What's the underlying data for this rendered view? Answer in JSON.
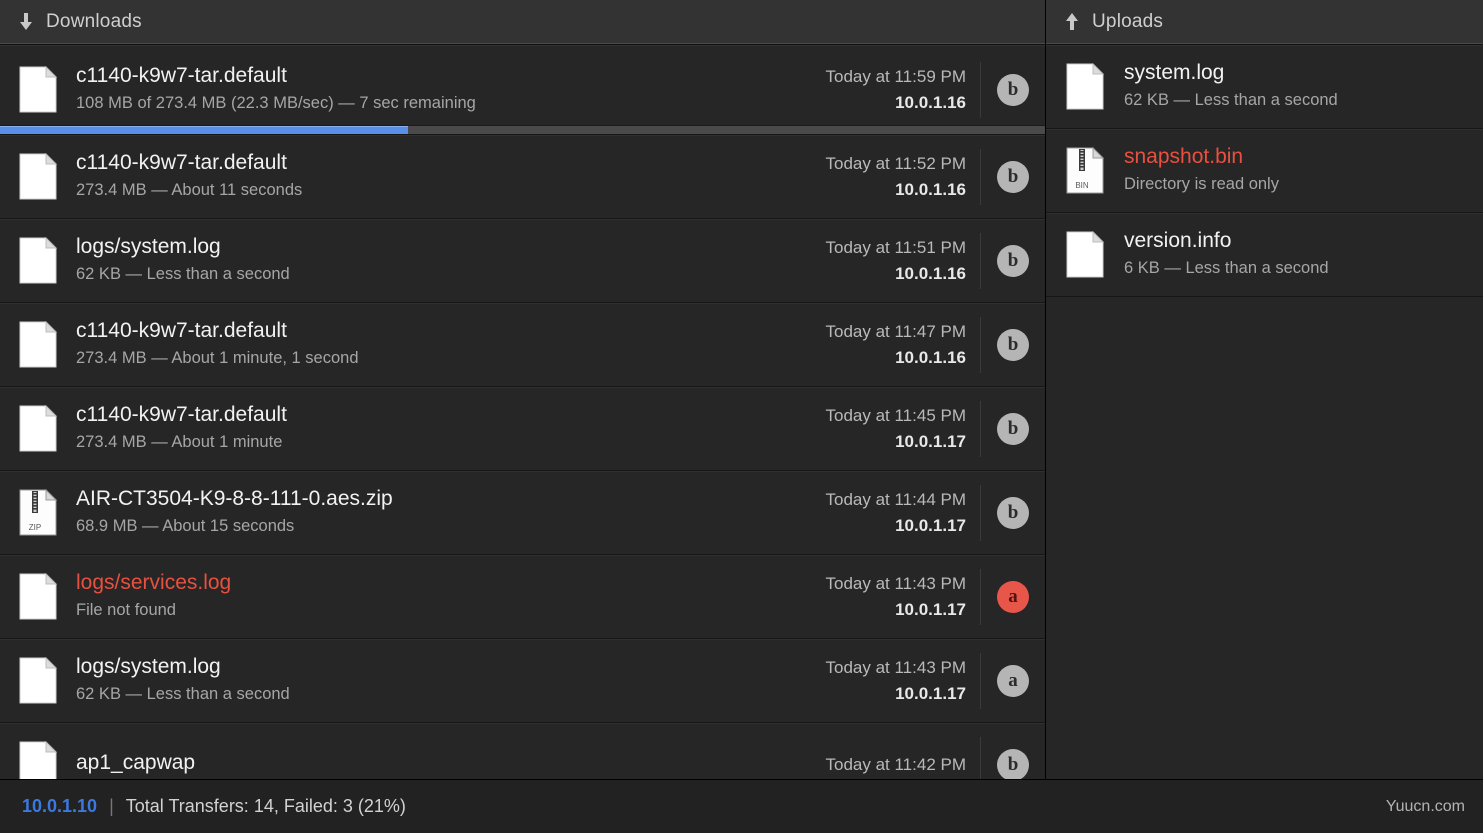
{
  "downloads": {
    "title": "Downloads",
    "icon": "download-arrow-icon",
    "rows": [
      {
        "name": "c1140-k9w7-tar.default",
        "meta": "108 MB of 273.4 MB (22.3 MB/sec) — 7 sec remaining",
        "time": "Today at 11:59 PM",
        "host": "10.0.1.16",
        "badge": "b",
        "badge_state": "normal",
        "file_icon": "document-icon",
        "error": false,
        "active": true,
        "progress_percent": 39
      },
      {
        "name": "c1140-k9w7-tar.default",
        "meta": "273.4 MB — About 11 seconds",
        "time": "Today at 11:52 PM",
        "host": "10.0.1.16",
        "badge": "b",
        "badge_state": "normal",
        "file_icon": "document-icon",
        "error": false,
        "active": false
      },
      {
        "name": "logs/system.log",
        "meta": "62 KB — Less than a second",
        "time": "Today at 11:51 PM",
        "host": "10.0.1.16",
        "badge": "b",
        "badge_state": "normal",
        "file_icon": "document-icon",
        "error": false,
        "active": false
      },
      {
        "name": "c1140-k9w7-tar.default",
        "meta": "273.4 MB — About 1 minute, 1 second",
        "time": "Today at 11:47 PM",
        "host": "10.0.1.16",
        "badge": "b",
        "badge_state": "normal",
        "file_icon": "document-icon",
        "error": false,
        "active": false
      },
      {
        "name": "c1140-k9w7-tar.default",
        "meta": "273.4 MB — About 1 minute",
        "time": "Today at 11:45 PM",
        "host": "10.0.1.17",
        "badge": "b",
        "badge_state": "normal",
        "file_icon": "document-icon",
        "error": false,
        "active": false
      },
      {
        "name": "AIR-CT3504-K9-8-8-111-0.aes.zip",
        "meta": "68.9 MB — About 15 seconds",
        "time": "Today at 11:44 PM",
        "host": "10.0.1.17",
        "badge": "b",
        "badge_state": "normal",
        "file_icon": "zip-icon",
        "error": false,
        "active": false
      },
      {
        "name": "logs/services.log",
        "meta": "File not found",
        "time": "Today at 11:43 PM",
        "host": "10.0.1.17",
        "badge": "a",
        "badge_state": "error",
        "file_icon": "document-icon",
        "error": true,
        "active": false
      },
      {
        "name": "logs/system.log",
        "meta": "62 KB — Less than a second",
        "time": "Today at 11:43 PM",
        "host": "10.0.1.17",
        "badge": "a",
        "badge_state": "normal",
        "file_icon": "document-icon",
        "error": false,
        "active": false
      },
      {
        "name": "ap1_capwap",
        "meta": "",
        "time": "Today at 11:42 PM",
        "host": "",
        "badge": "b",
        "badge_state": "normal",
        "file_icon": "document-icon",
        "error": false,
        "active": false
      }
    ]
  },
  "uploads": {
    "title": "Uploads",
    "icon": "upload-arrow-icon",
    "rows": [
      {
        "name": "system.log",
        "meta": "62 KB — Less than a second",
        "file_icon": "document-icon",
        "error": false
      },
      {
        "name": "snapshot.bin",
        "meta": "Directory is read only",
        "file_icon": "bin-icon",
        "error": true
      },
      {
        "name": "version.info",
        "meta": "6 KB — Less than a second",
        "file_icon": "document-icon",
        "error": false
      }
    ]
  },
  "statusbar": {
    "ip": "10.0.1.10",
    "separator": "|",
    "summary": "Total Transfers: 14, Failed: 3 (21%)",
    "watermark": "Yuucn.com"
  },
  "colors": {
    "accent_blue": "#3b79e0",
    "progress_blue": "#5a8fe8",
    "error_red": "#e8503f",
    "badge_gray": "#b5b5b5",
    "badge_error": "#e8564a",
    "row_bg": "#262626",
    "header_bg": "#333333",
    "status_bg": "#222222"
  }
}
